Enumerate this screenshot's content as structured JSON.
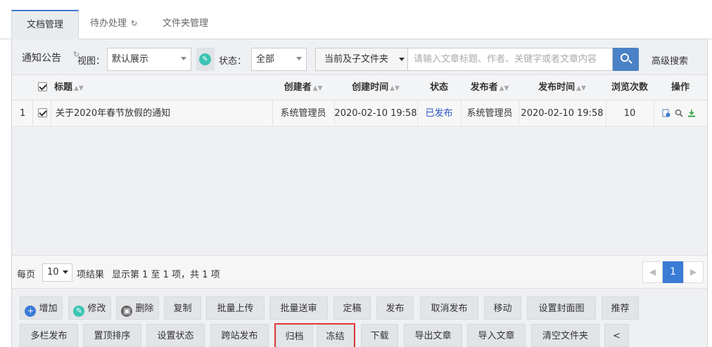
{
  "tabs": [
    {
      "label": "文档管理",
      "active": true
    },
    {
      "label": "待办处理",
      "icon": "refresh-icon"
    },
    {
      "label": "文件夹管理"
    }
  ],
  "toolbar": {
    "title": "通知公告",
    "view_label": "视图：",
    "view_value": "默认展示",
    "status_label": "状态：",
    "status_value": "全部",
    "scope_value": "当前及子文件夹",
    "search_placeholder": "请输入文章标题、作者、关键字或者文章内容",
    "advanced_search": "高级搜索"
  },
  "table": {
    "columns": [
      "标题",
      "创建者",
      "创建时间",
      "状态",
      "发布者",
      "发布时间",
      "浏览次数",
      "操作"
    ],
    "rows": [
      {
        "index": "1",
        "checked": true,
        "title": "关于2020年春节放假的通知",
        "creator": "系统管理员",
        "created": "2020-02-10 19:58",
        "status": "已发布",
        "publisher": "系统管理员",
        "published": "2020-02-10 19:58",
        "views": "10",
        "ops": [
          "edit-doc-icon",
          "view-icon",
          "download-icon"
        ]
      }
    ]
  },
  "pager": {
    "per_page_label": "每页",
    "page_size": "10",
    "result_label": "项结果",
    "summary": "显示第 1 至 1 项，共 1 项",
    "prev": "◀",
    "current": "1",
    "next": "▶"
  },
  "actions": {
    "row1": [
      "增加",
      "修改",
      "删除",
      "复制",
      "批量上传",
      "批量送审",
      "定稿",
      "发布",
      "取消发布",
      "移动",
      "设置封面图",
      "推荐"
    ],
    "row2": [
      "多栏发布",
      "置顶排序",
      "设置状态",
      "跨站发布",
      "归档",
      "冻结",
      "下载",
      "导出文章",
      "导入文章",
      "清空文件夹",
      "<"
    ]
  },
  "colors": {
    "accent": "#3a7bd5",
    "published_status": "#2a55c7",
    "highlight_box": "#e03a3a",
    "add_icon": "#3a7bd5",
    "edit_icon": "#3cc4b4",
    "delete_icon": "#666666"
  }
}
